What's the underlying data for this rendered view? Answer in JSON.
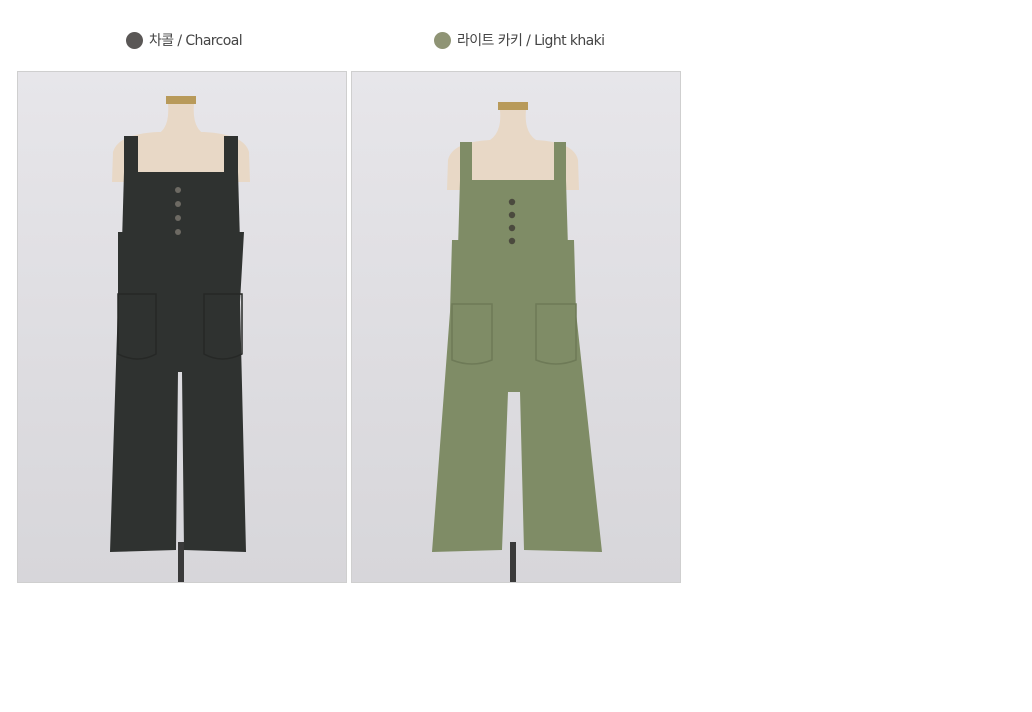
{
  "variants": [
    {
      "label": "차콜 / Charcoal",
      "swatch_color": "#5a5756",
      "garment_color": "#2f3230",
      "icon": "color-swatch-icon"
    },
    {
      "label": "라이트 카키 / Light khaki",
      "swatch_color": "#8f9475",
      "garment_color": "#7f8c66",
      "icon": "color-swatch-icon"
    }
  ],
  "colors": {
    "photo_background": "#e2e1e5",
    "mannequin": "#e8d8c6",
    "stand": "#3a3a3a",
    "border": "#cfcfcf"
  }
}
